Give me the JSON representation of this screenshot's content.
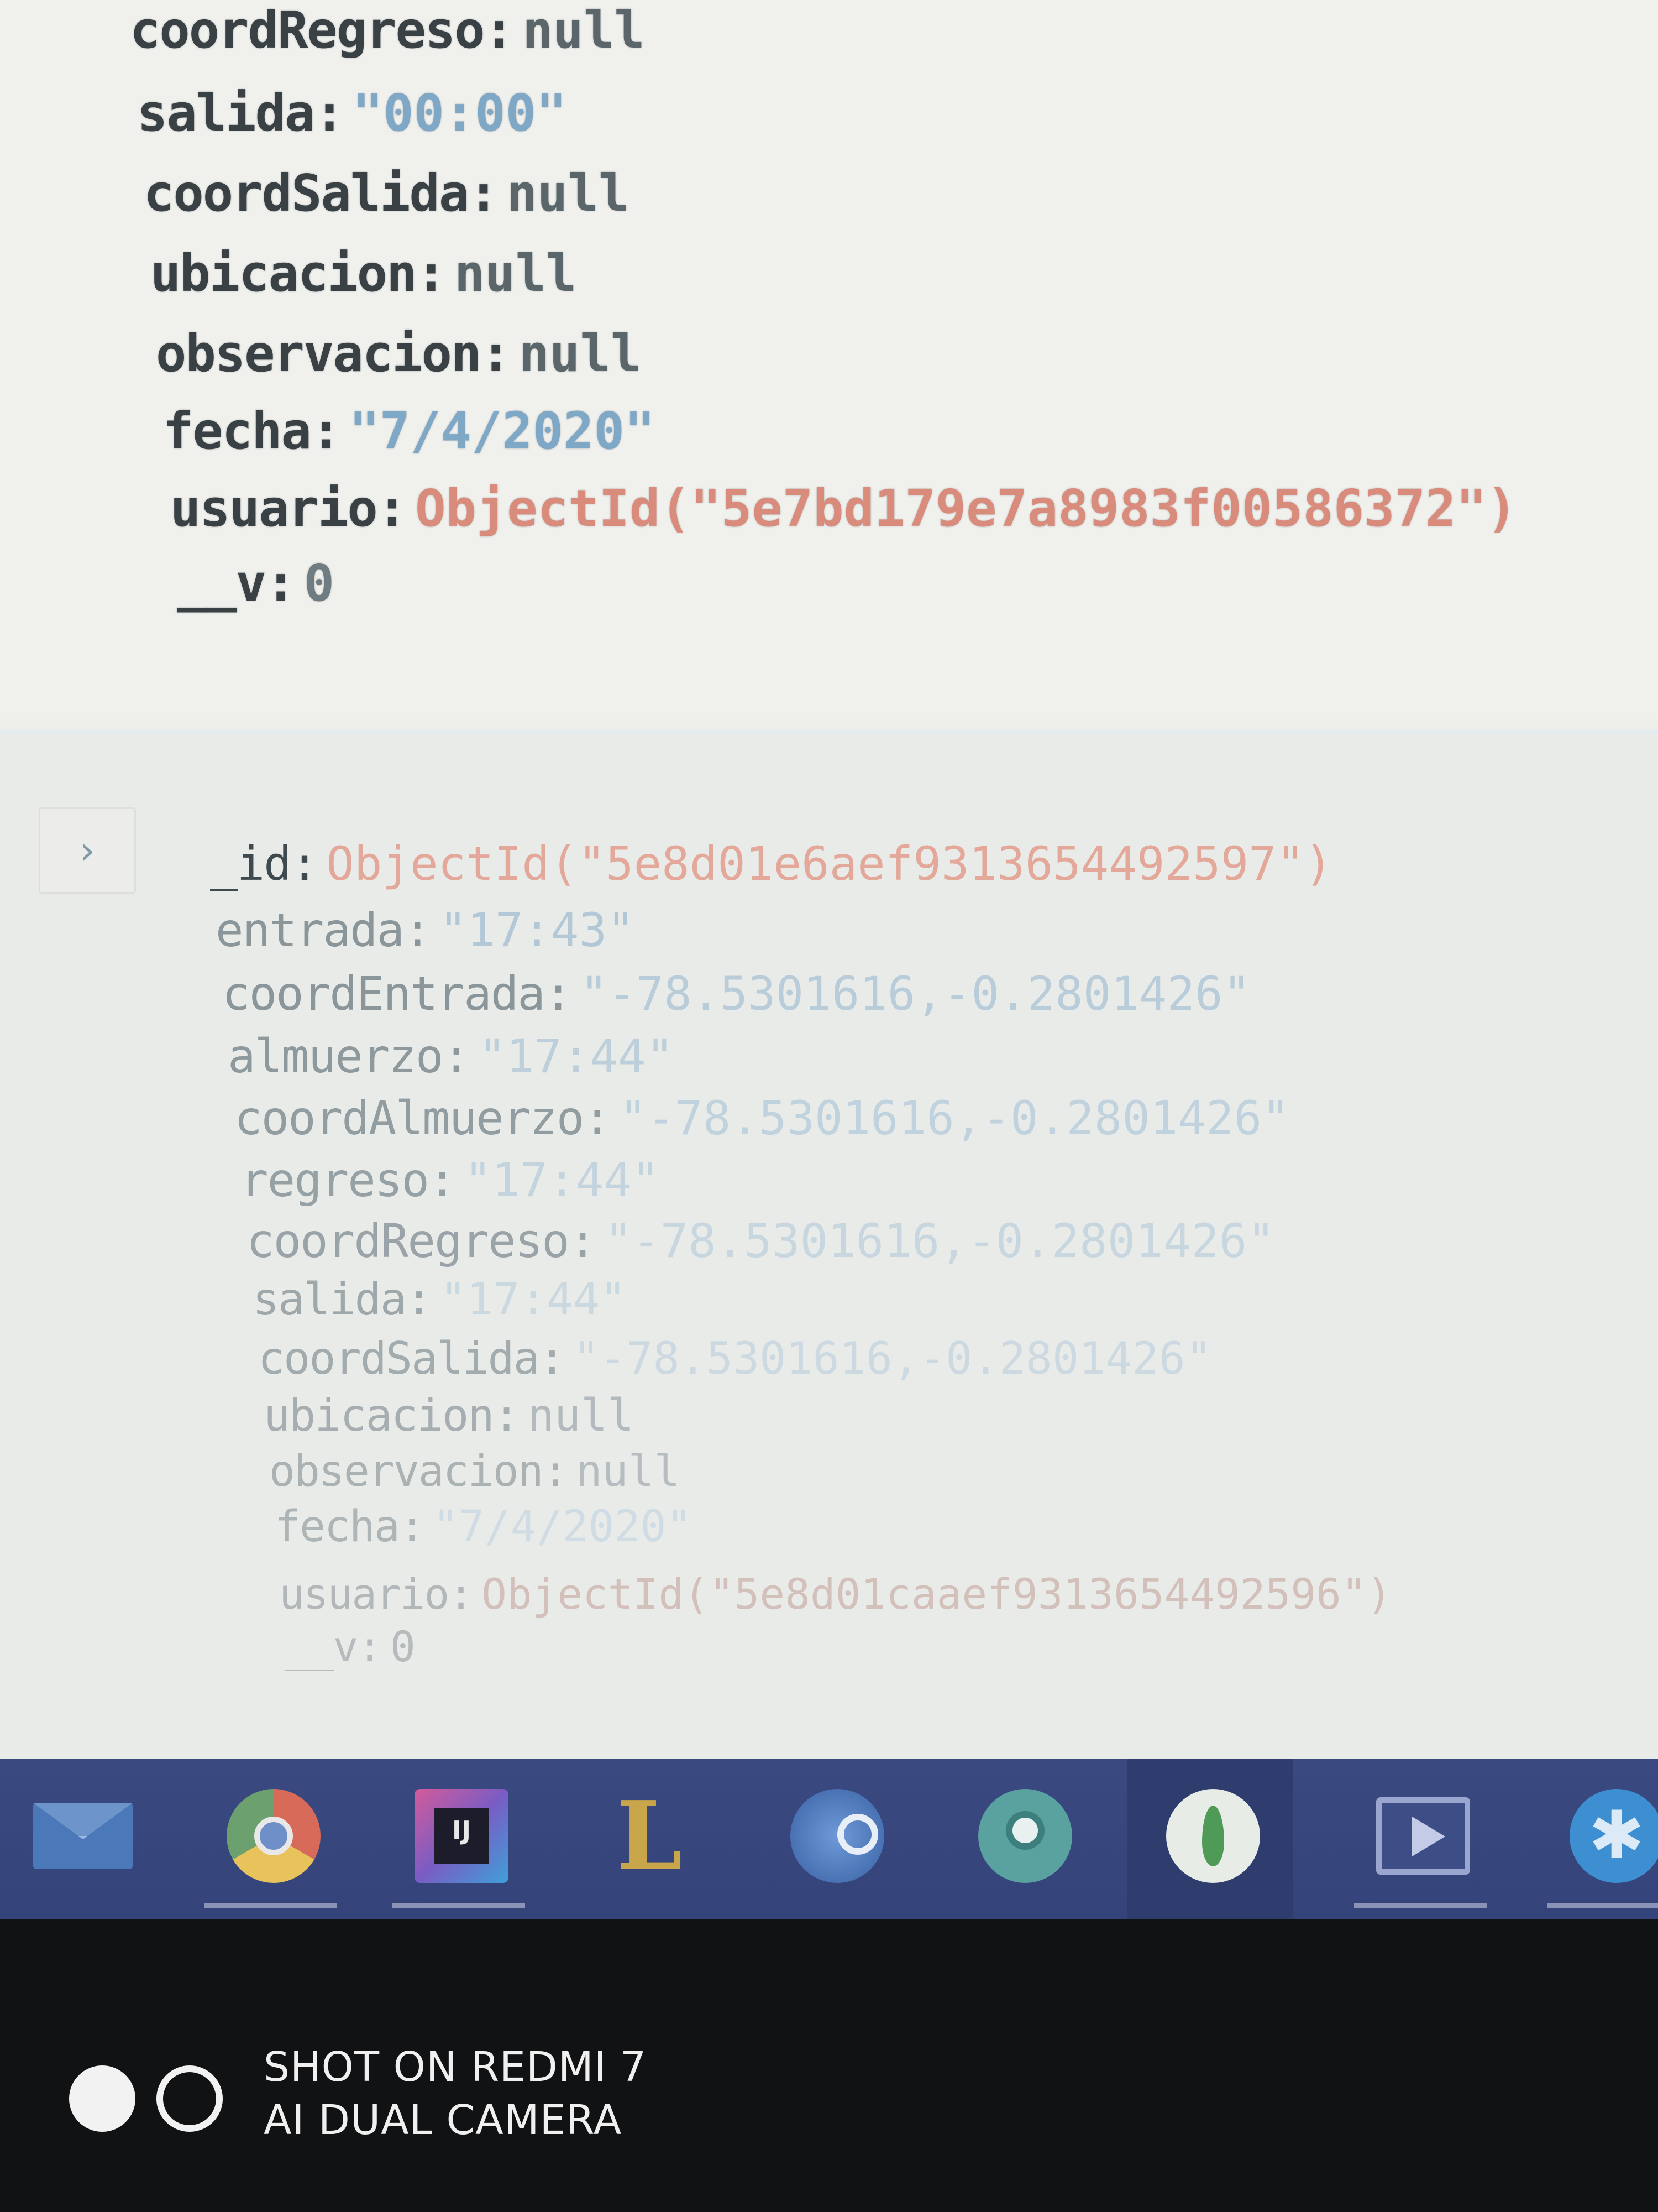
{
  "document_1": {
    "fields": [
      {
        "key": "coordRegreso",
        "value": "null",
        "type": "null"
      },
      {
        "key": "salida",
        "value": "\"00:00\"",
        "type": "str"
      },
      {
        "key": "coordSalida",
        "value": "null",
        "type": "null"
      },
      {
        "key": "ubicacion",
        "value": "null",
        "type": "null"
      },
      {
        "key": "observacion",
        "value": "null",
        "type": "null"
      },
      {
        "key": "fecha",
        "value": "\"7/4/2020\"",
        "type": "str"
      },
      {
        "key": "usuario",
        "value": "ObjectId(\"5e7bd179e7a8983f00586372\")",
        "type": "oid"
      },
      {
        "key": "__v",
        "value": "0",
        "type": "num"
      }
    ]
  },
  "document_2": {
    "expand_glyph": "›",
    "fields": [
      {
        "key": "_id",
        "value": "ObjectId(\"5e8d01e6aef9313654492597\")",
        "type": "oid"
      },
      {
        "key": "entrada",
        "value": "\"17:43\"",
        "type": "str"
      },
      {
        "key": "coordEntrada",
        "value": "\"-78.5301616,-0.2801426\"",
        "type": "str"
      },
      {
        "key": "almuerzo",
        "value": "\"17:44\"",
        "type": "str"
      },
      {
        "key": "coordAlmuerzo",
        "value": "\"-78.5301616,-0.2801426\"",
        "type": "str"
      },
      {
        "key": "regreso",
        "value": "\"17:44\"",
        "type": "str"
      },
      {
        "key": "coordRegreso",
        "value": "\"-78.5301616,-0.2801426\"",
        "type": "str"
      },
      {
        "key": "salida",
        "value": "\"17:44\"",
        "type": "str"
      },
      {
        "key": "coordSalida",
        "value": "\"-78.5301616,-0.2801426\"",
        "type": "str"
      },
      {
        "key": "ubicacion",
        "value": "null",
        "type": "null"
      },
      {
        "key": "observacion",
        "value": "null",
        "type": "null"
      },
      {
        "key": "fecha",
        "value": "\"7/4/2020\"",
        "type": "str"
      },
      {
        "key": "usuario",
        "value": "ObjectId(\"5e8d01caaef9313654492596\")",
        "type": "oid"
      },
      {
        "key": "__v",
        "value": "0",
        "type": "num"
      }
    ]
  },
  "taskbar": {
    "items": [
      {
        "icon": "mail-icon",
        "active": false,
        "underline": false
      },
      {
        "icon": "chrome-icon",
        "active": false,
        "underline": true
      },
      {
        "icon": "intellij-icon",
        "active": false,
        "underline": true,
        "glyph": "IJ"
      },
      {
        "icon": "league-of-legends-icon",
        "active": false,
        "underline": false,
        "glyph": "L"
      },
      {
        "icon": "steam-icon",
        "active": false,
        "underline": false
      },
      {
        "icon": "webcam-icon",
        "active": false,
        "underline": false
      },
      {
        "icon": "mongodb-compass-icon",
        "active": true,
        "underline": false
      },
      {
        "icon": "video-player-icon",
        "active": false,
        "underline": true
      },
      {
        "icon": "bluetooth-icon",
        "active": false,
        "underline": true,
        "glyph": "✱"
      }
    ]
  },
  "watermark": {
    "line1": "SHOT ON REDMI 7",
    "line2": "AI DUAL CAMERA"
  },
  "colors": {
    "key_text": "#3a4145",
    "null_value": "#5a666a",
    "string_value": "#7fa8c7",
    "objectid_value": "#d98b7c",
    "taskbar": "#3a4a80"
  }
}
